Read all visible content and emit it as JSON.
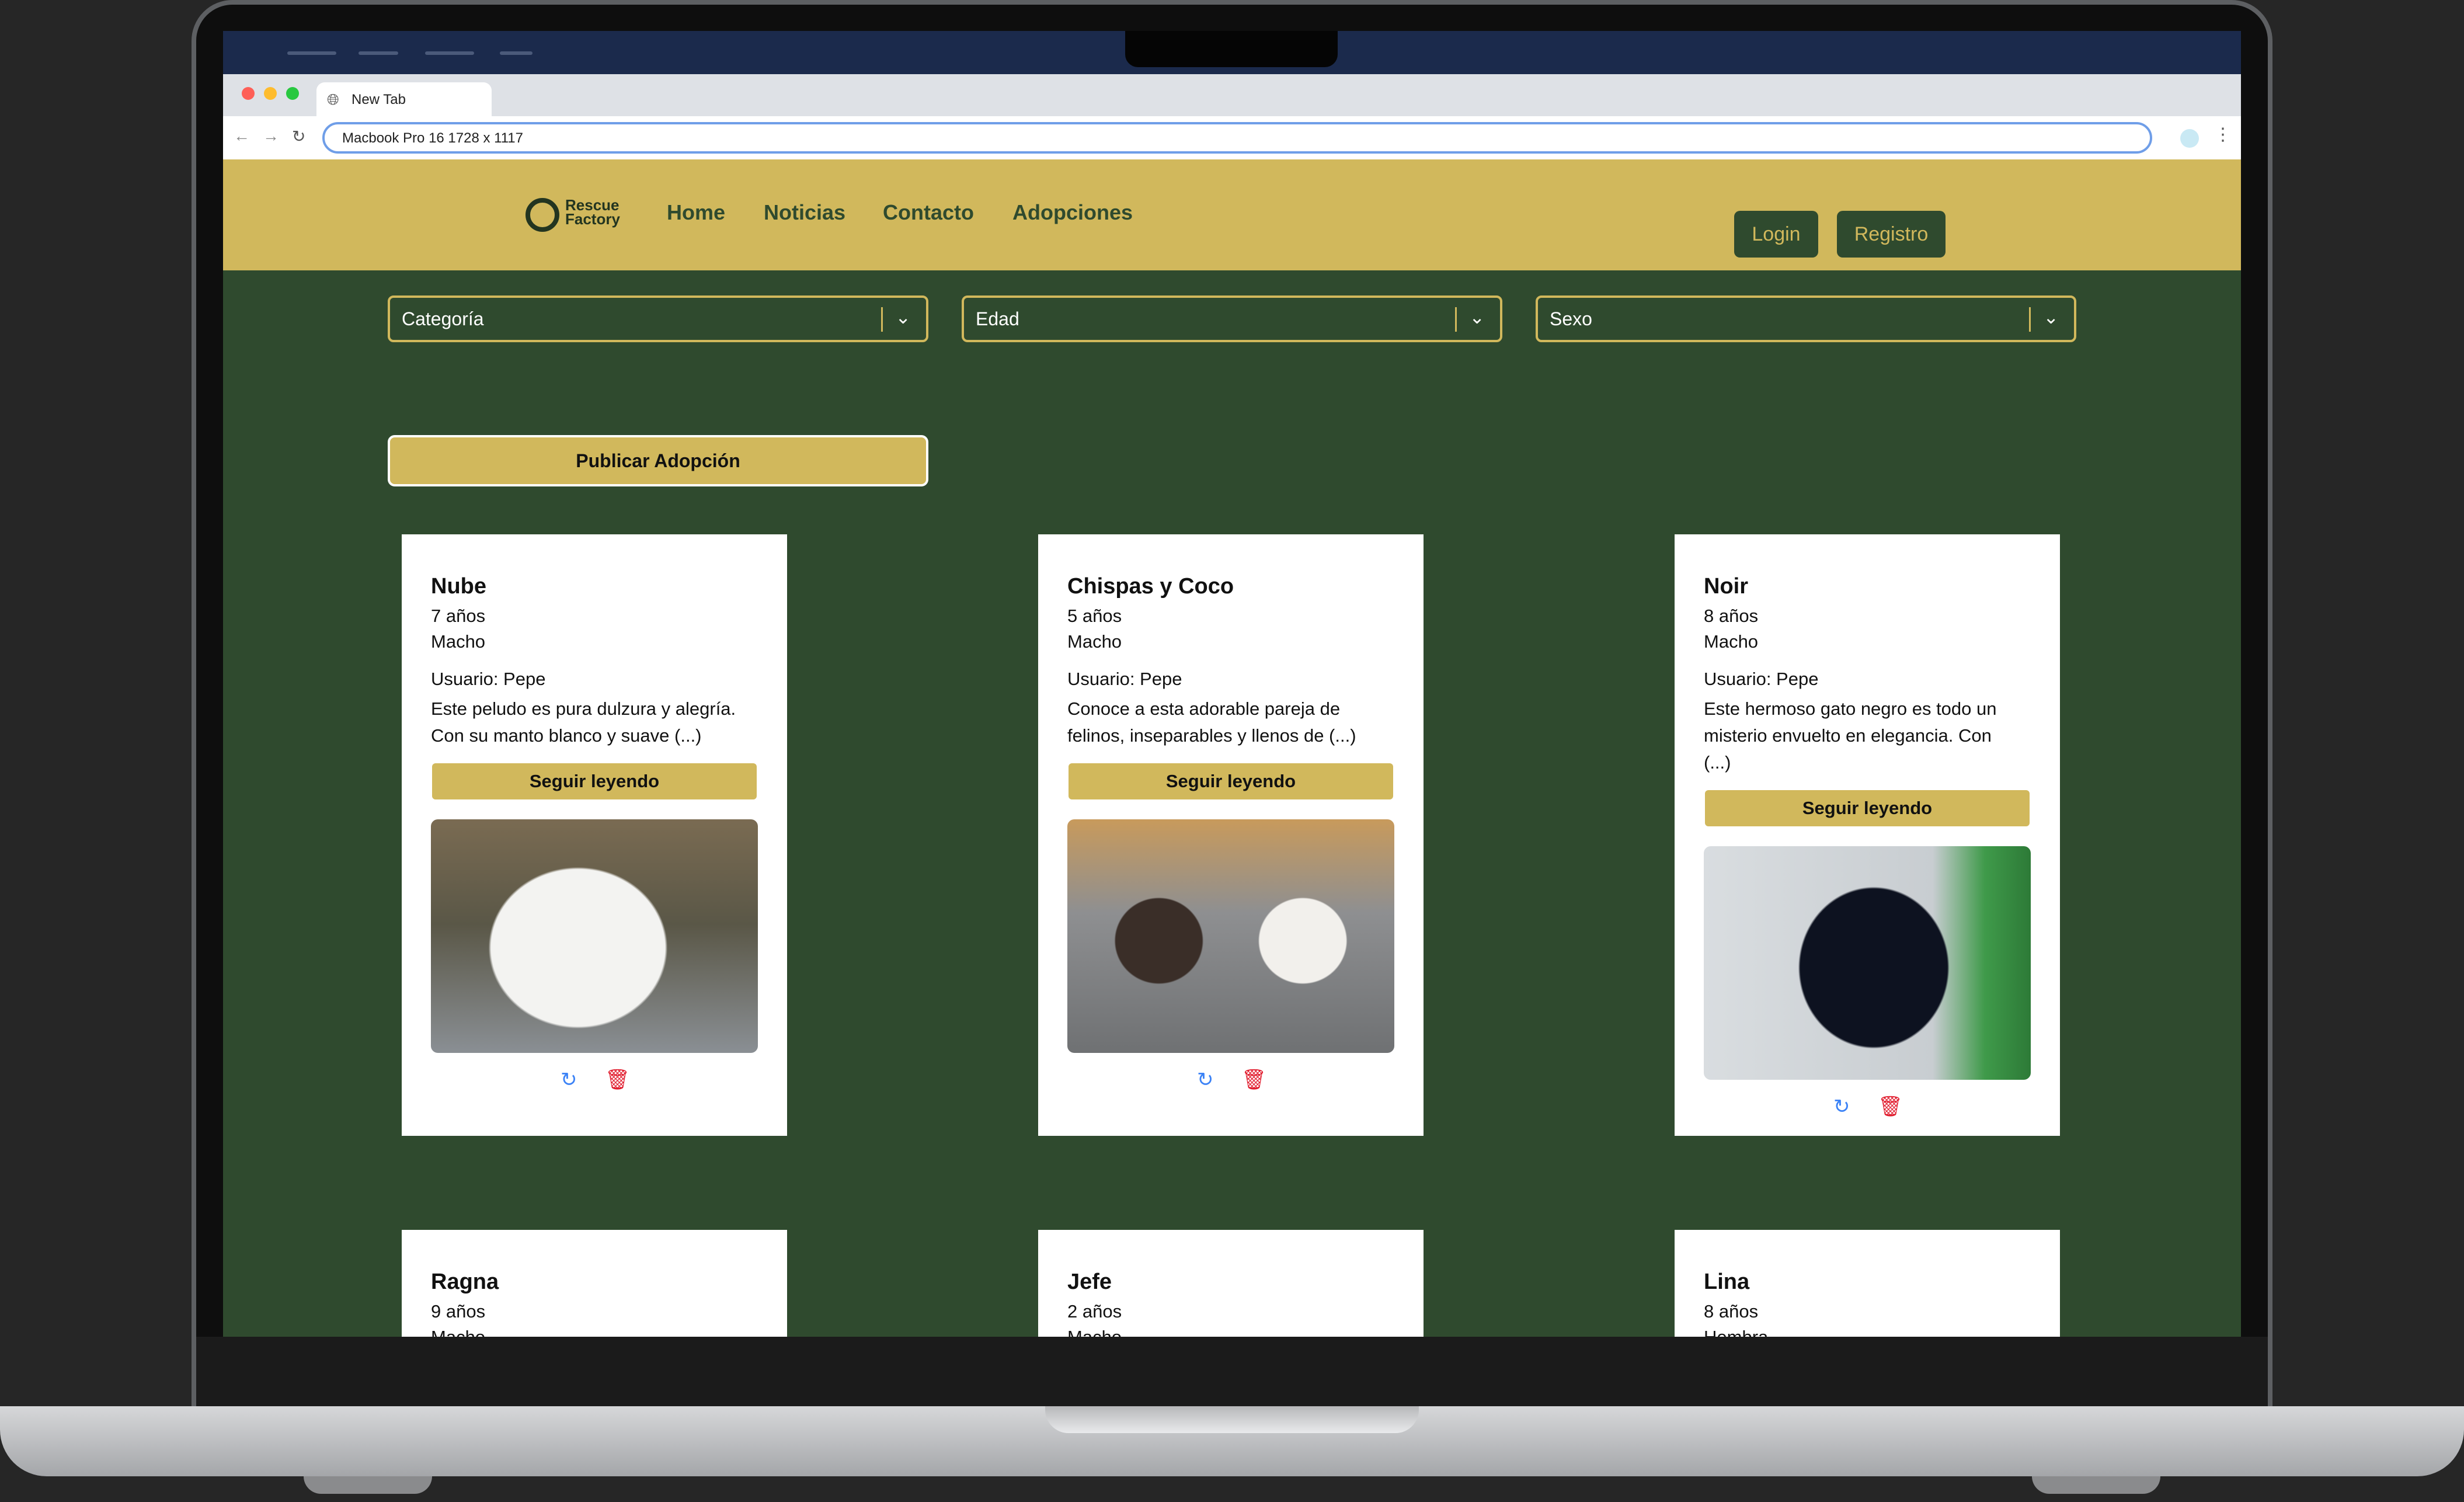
{
  "browser": {
    "tab_title": "New Tab",
    "address": "Macbook Pro 16  1728 x 1117"
  },
  "header": {
    "logo_line1": "Rescue",
    "logo_line2": "Factory",
    "nav": [
      "Home",
      "Noticias",
      "Contacto",
      "Adopciones"
    ],
    "login": "Login",
    "register": "Registro"
  },
  "filters": [
    "Categoría",
    "Edad",
    "Sexo"
  ],
  "publish_label": "Publicar Adopción",
  "read_more_label": "Seguir leyendo",
  "icons": {
    "refresh": "refresh-icon",
    "delete": "trash-icon"
  },
  "colors": {
    "brand_gold": "#d1b85c",
    "brand_green": "#2f4a2e"
  },
  "pets": [
    {
      "name": "Nube",
      "age": "7 años",
      "sex": "Macho",
      "user": "Usuario: Pepe",
      "desc1": "Este peludo es pura dulzura y alegría.",
      "desc2": "Con su manto blanco y suave (...)",
      "desc3": ""
    },
    {
      "name": "Chispas y Coco",
      "age": "5 años",
      "sex": "Macho",
      "user": "Usuario: Pepe",
      "desc1": "Conoce a esta adorable pareja de",
      "desc2": "felinos, inseparables y llenos de (...)",
      "desc3": ""
    },
    {
      "name": "Noir",
      "age": "8 años",
      "sex": "Macho",
      "user": "Usuario: Pepe",
      "desc1": "Este hermoso gato negro es todo un",
      "desc2": "misterio envuelto en elegancia. Con",
      "desc3": "(...)"
    },
    {
      "name": "Ragna",
      "age": "9 años",
      "sex": "Macho"
    },
    {
      "name": "Jefe",
      "age": "2 años",
      "sex": "Macho"
    },
    {
      "name": "Lina",
      "age": "8 años",
      "sex": "Hembra"
    }
  ]
}
